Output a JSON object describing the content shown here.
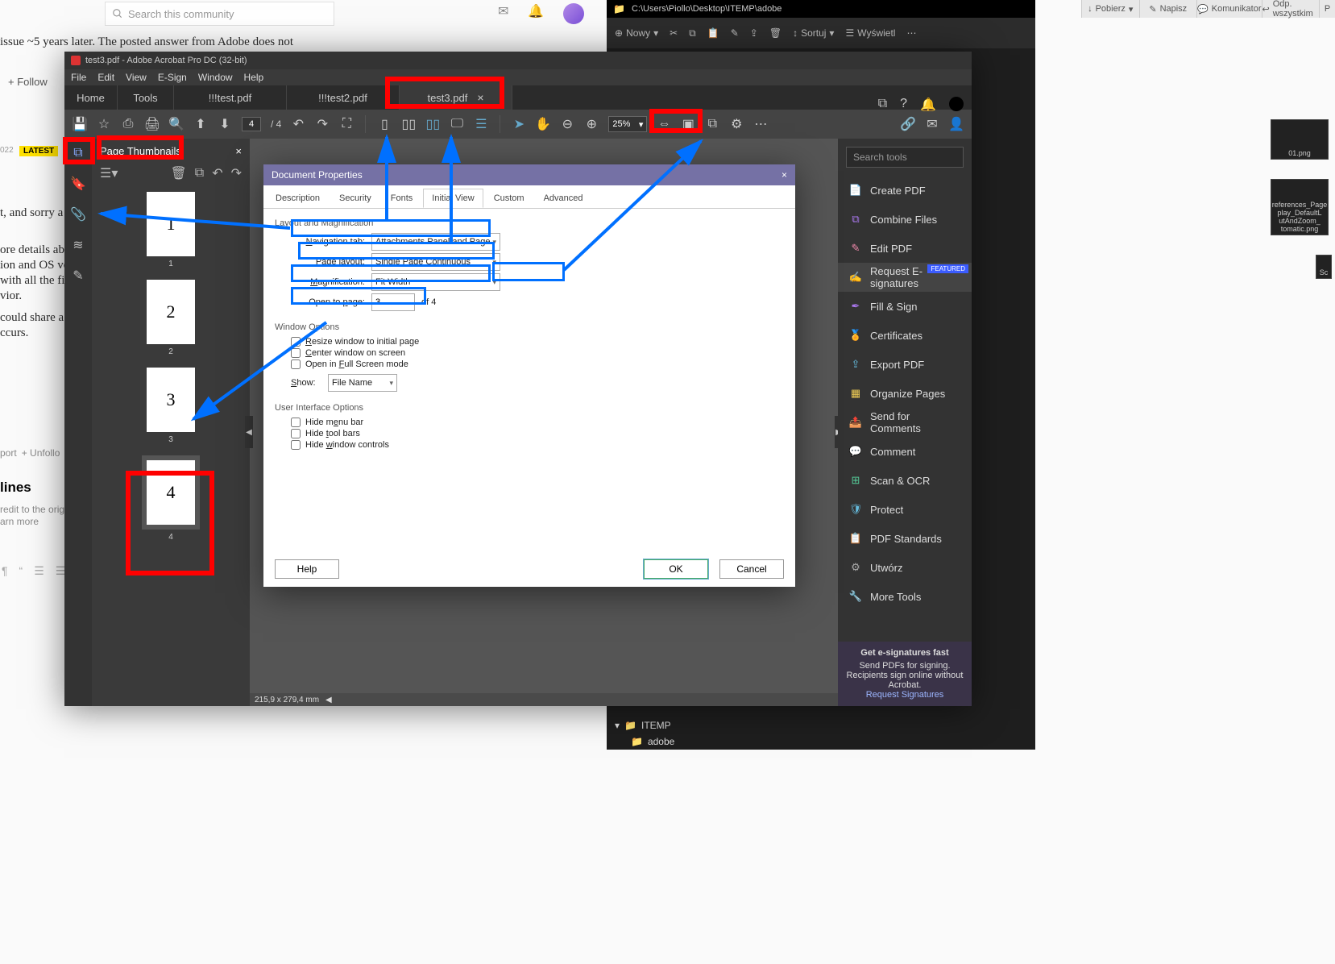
{
  "browser": {
    "search_placeholder": "Search this community",
    "headline_fragment": "issue ~5 years later. The posted answer from Adobe does not",
    "follow_label": "+ Follow",
    "latest_badge": "LATEST",
    "date_fragment": "022",
    "text_fragments": [
      "t, and sorry a",
      "ore details abo",
      "ion and OS ve",
      "with all the file",
      "vior.",
      "could share a",
      "ccurs."
    ],
    "report": "port",
    "unfollow": "+  Unfollo",
    "lines": "lines",
    "credit1": "redit to the origina",
    "credit2": "arn more"
  },
  "top_tabs": [
    "Pobierz",
    "Napisz",
    "Komunikator",
    "Odp. wszystkim",
    "P"
  ],
  "explorer": {
    "path": "C:\\Users\\Piollo\\Desktop\\ITEMP\\adobe",
    "new": "Nowy",
    "sort": "Sortuj",
    "view": "Wyświetl",
    "tree_folder": "ITEMP",
    "tree_sub": "adobe"
  },
  "far_thumbs": [
    "01.png",
    "references_Page\nplay_DefaultL\nutAndZoom_\ntomatic.png",
    "Sc"
  ],
  "acrobat": {
    "title": "test3.pdf - Adobe Acrobat Pro DC (32-bit)",
    "menus": [
      "File",
      "Edit",
      "View",
      "E-Sign",
      "Window",
      "Help"
    ],
    "tabs": {
      "home": "Home",
      "tools": "Tools",
      "docs": [
        "!!!test.pdf",
        "!!!test2.pdf",
        "test3.pdf"
      ]
    },
    "page_current": "4",
    "page_total": "/  4",
    "zoom": "25%",
    "thumbnails_title": "Page Thumbnails",
    "thumb_labels": [
      "1",
      "2",
      "3",
      "4"
    ],
    "thumb_nums": [
      "1",
      "2",
      "3",
      "4"
    ],
    "status": "215,9 x 279,4 mm",
    "right_search": "Search tools",
    "right_tools": [
      "Create PDF",
      "Combine Files",
      "Edit PDF",
      "Request E-signatures",
      "Fill & Sign",
      "Certificates",
      "Export PDF",
      "Organize Pages",
      "Send for Comments",
      "Comment",
      "Scan & OCR",
      "Protect",
      "PDF Standards",
      "Utwórz",
      "More Tools"
    ],
    "featured_label": "FEATURED",
    "promo_title": "Get e-signatures fast",
    "promo_text": "Send PDFs for signing. Recipients sign online without Acrobat.",
    "promo_link": "Request Signatures"
  },
  "dialog": {
    "title": "Document Properties",
    "tabs": [
      "Description",
      "Security",
      "Fonts",
      "Initial View",
      "Custom",
      "Advanced"
    ],
    "group_layout": "Layout and Magnification",
    "nav_label": "Navigation tab:",
    "nav_value": "Attachments Panel and Page",
    "layout_label": "Page layout:",
    "layout_value": "Single Page Continuous",
    "mag_label": "Magnification:",
    "mag_value": "Fit Width",
    "open_label": "Open to page:",
    "open_value": "3",
    "open_of": "of 4",
    "group_window": "Window Options",
    "chk_resize": "Resize window to initial page",
    "chk_center": "Center window on screen",
    "chk_full": "Open in Full Screen mode",
    "show_label": "Show:",
    "show_value": "File Name",
    "group_ui": "User Interface Options",
    "chk_menu": "Hide menu bar",
    "chk_tool": "Hide tool bars",
    "chk_wnd": "Hide window controls",
    "btn_help": "Help",
    "btn_ok": "OK",
    "btn_cancel": "Cancel"
  }
}
